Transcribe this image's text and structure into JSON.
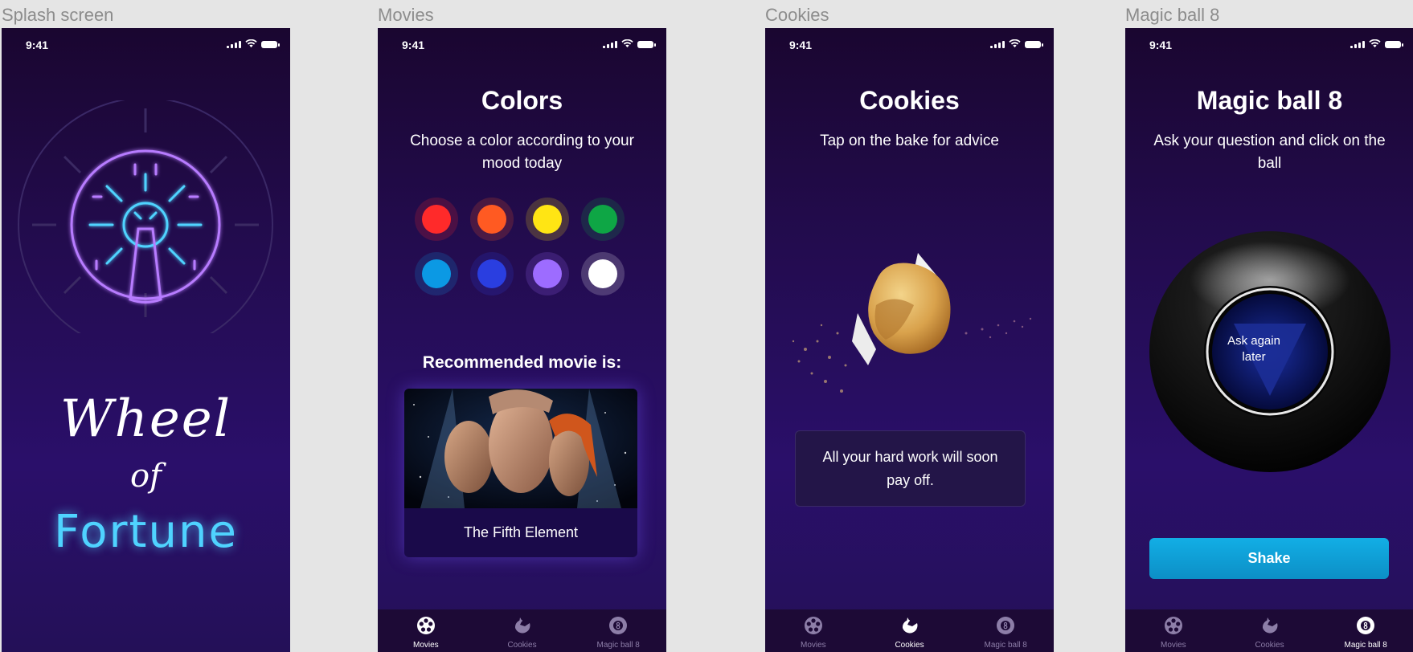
{
  "frames": {
    "splash": "Splash screen",
    "movies": "Movies",
    "cookies": "Cookies",
    "magic": "Magic ball 8"
  },
  "status": {
    "time": "9:41"
  },
  "splash": {
    "word1": "Wheel",
    "word2": "of",
    "word3": "Fortune"
  },
  "movies_screen": {
    "title": "Colors",
    "subtitle": "Choose a color according to your mood today",
    "colors": [
      "#ff2a2a",
      "#ff5a22",
      "#ffe514",
      "#0ea645",
      "#0b99e4",
      "#2a3ee0",
      "#9d6cff",
      "#ffffff"
    ],
    "recommended_label": "Recommended movie is:",
    "movie_title": "The Fifth Element"
  },
  "cookies_screen": {
    "title": "Cookies",
    "subtitle": "Tap on the bake for advice",
    "advice": "All your hard work will soon pay off."
  },
  "magic_screen": {
    "title": "Magic ball 8",
    "subtitle": "Ask your question and click on the ball",
    "answer": "Ask again later",
    "shake_label": "Shake"
  },
  "tabs": {
    "movies": "Movies",
    "cookies": "Cookies",
    "magic": "Magic ball 8"
  },
  "accent_colors": {
    "tab_bar": "#1d0a36",
    "shake_button": "#12aee5",
    "neon_blue": "#4fd3ff",
    "neon_purple": "#b77bff"
  }
}
